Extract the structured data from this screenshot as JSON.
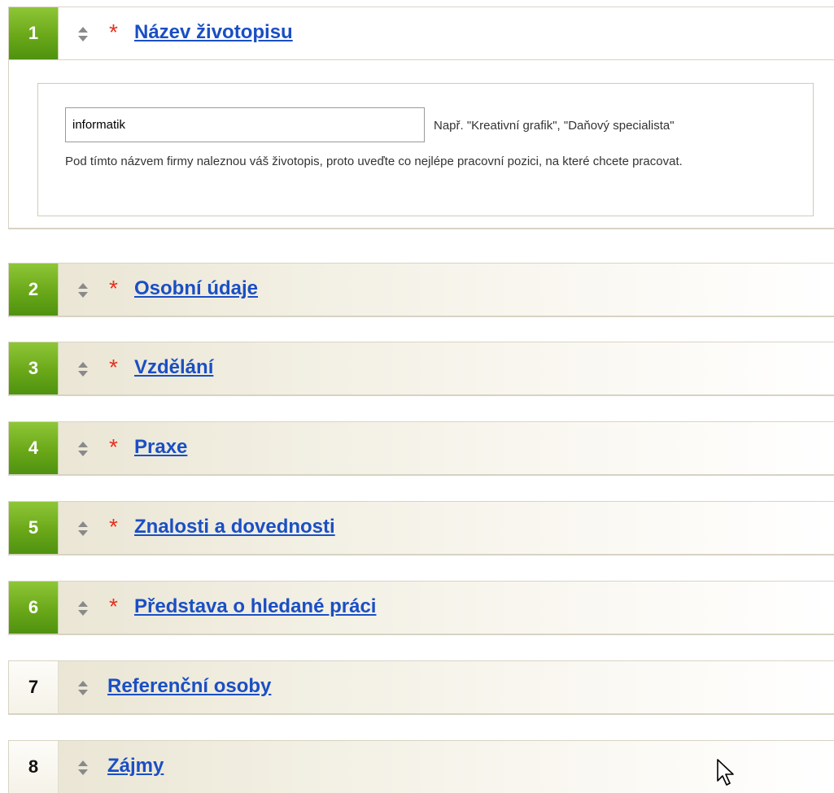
{
  "sections": [
    {
      "number": "1",
      "title": "Název životopisu",
      "required": true,
      "active": true
    },
    {
      "number": "2",
      "title": "Osobní údaje",
      "required": true,
      "active": true
    },
    {
      "number": "3",
      "title": "Vzdělání",
      "required": true,
      "active": true
    },
    {
      "number": "4",
      "title": "Praxe",
      "required": true,
      "active": true
    },
    {
      "number": "5",
      "title": "Znalosti a dovednosti",
      "required": true,
      "active": true
    },
    {
      "number": "6",
      "title": "Představa o hledané práci",
      "required": true,
      "active": true
    },
    {
      "number": "7",
      "title": "Referenční osoby",
      "required": false,
      "active": false
    },
    {
      "number": "8",
      "title": "Zájmy",
      "required": false,
      "active": false
    }
  ],
  "required_marker": "*",
  "cv_title_form": {
    "input_value": "informatik",
    "example_text": "Např. \"Kreativní grafik\", \"Daňový specialista\"",
    "hint_text": "Pod tímto názvem firmy naleznou váš životopis, proto uveďte co nejlépe pracovní pozici, na které chcete pracovat."
  },
  "colors": {
    "accent_green": "#6aa819",
    "link_blue": "#1a4fc4",
    "required_red": "#e8301e"
  },
  "icons": {
    "reorder": "updown-arrows-icon",
    "pointer": "mouse-cursor-icon"
  }
}
